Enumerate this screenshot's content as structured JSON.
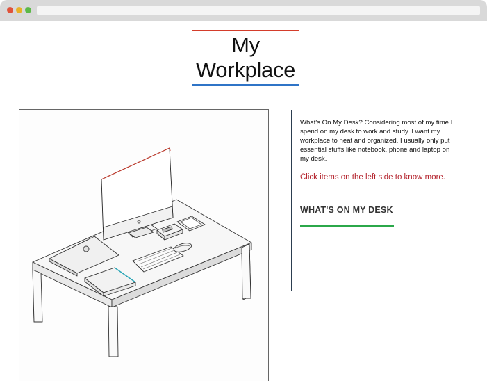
{
  "window": {
    "controls": [
      "close",
      "minimize",
      "zoom"
    ]
  },
  "header": {
    "title_line1": "My",
    "title_line2": "Workplace",
    "accent_top": "#d43d2b",
    "accent_bottom": "#2f74c7"
  },
  "info": {
    "description": "What's On My Desk? Considering most of my time I spend on my desk to work and study. I want my workplace to neat and organized. I usually only put essential stuffs like notebook, phone and laptop on my desk.",
    "cta": "Click items on the left side to know more.",
    "section_heading": "WHAT'S ON MY DESK",
    "accent_cta": "#b3202a",
    "accent_section": "#2ba84a"
  },
  "illustration": {
    "items": [
      "desk",
      "monitor",
      "laptop",
      "notebook",
      "keyboard",
      "mouse",
      "phone",
      "hard-drive",
      "trackpad"
    ]
  }
}
